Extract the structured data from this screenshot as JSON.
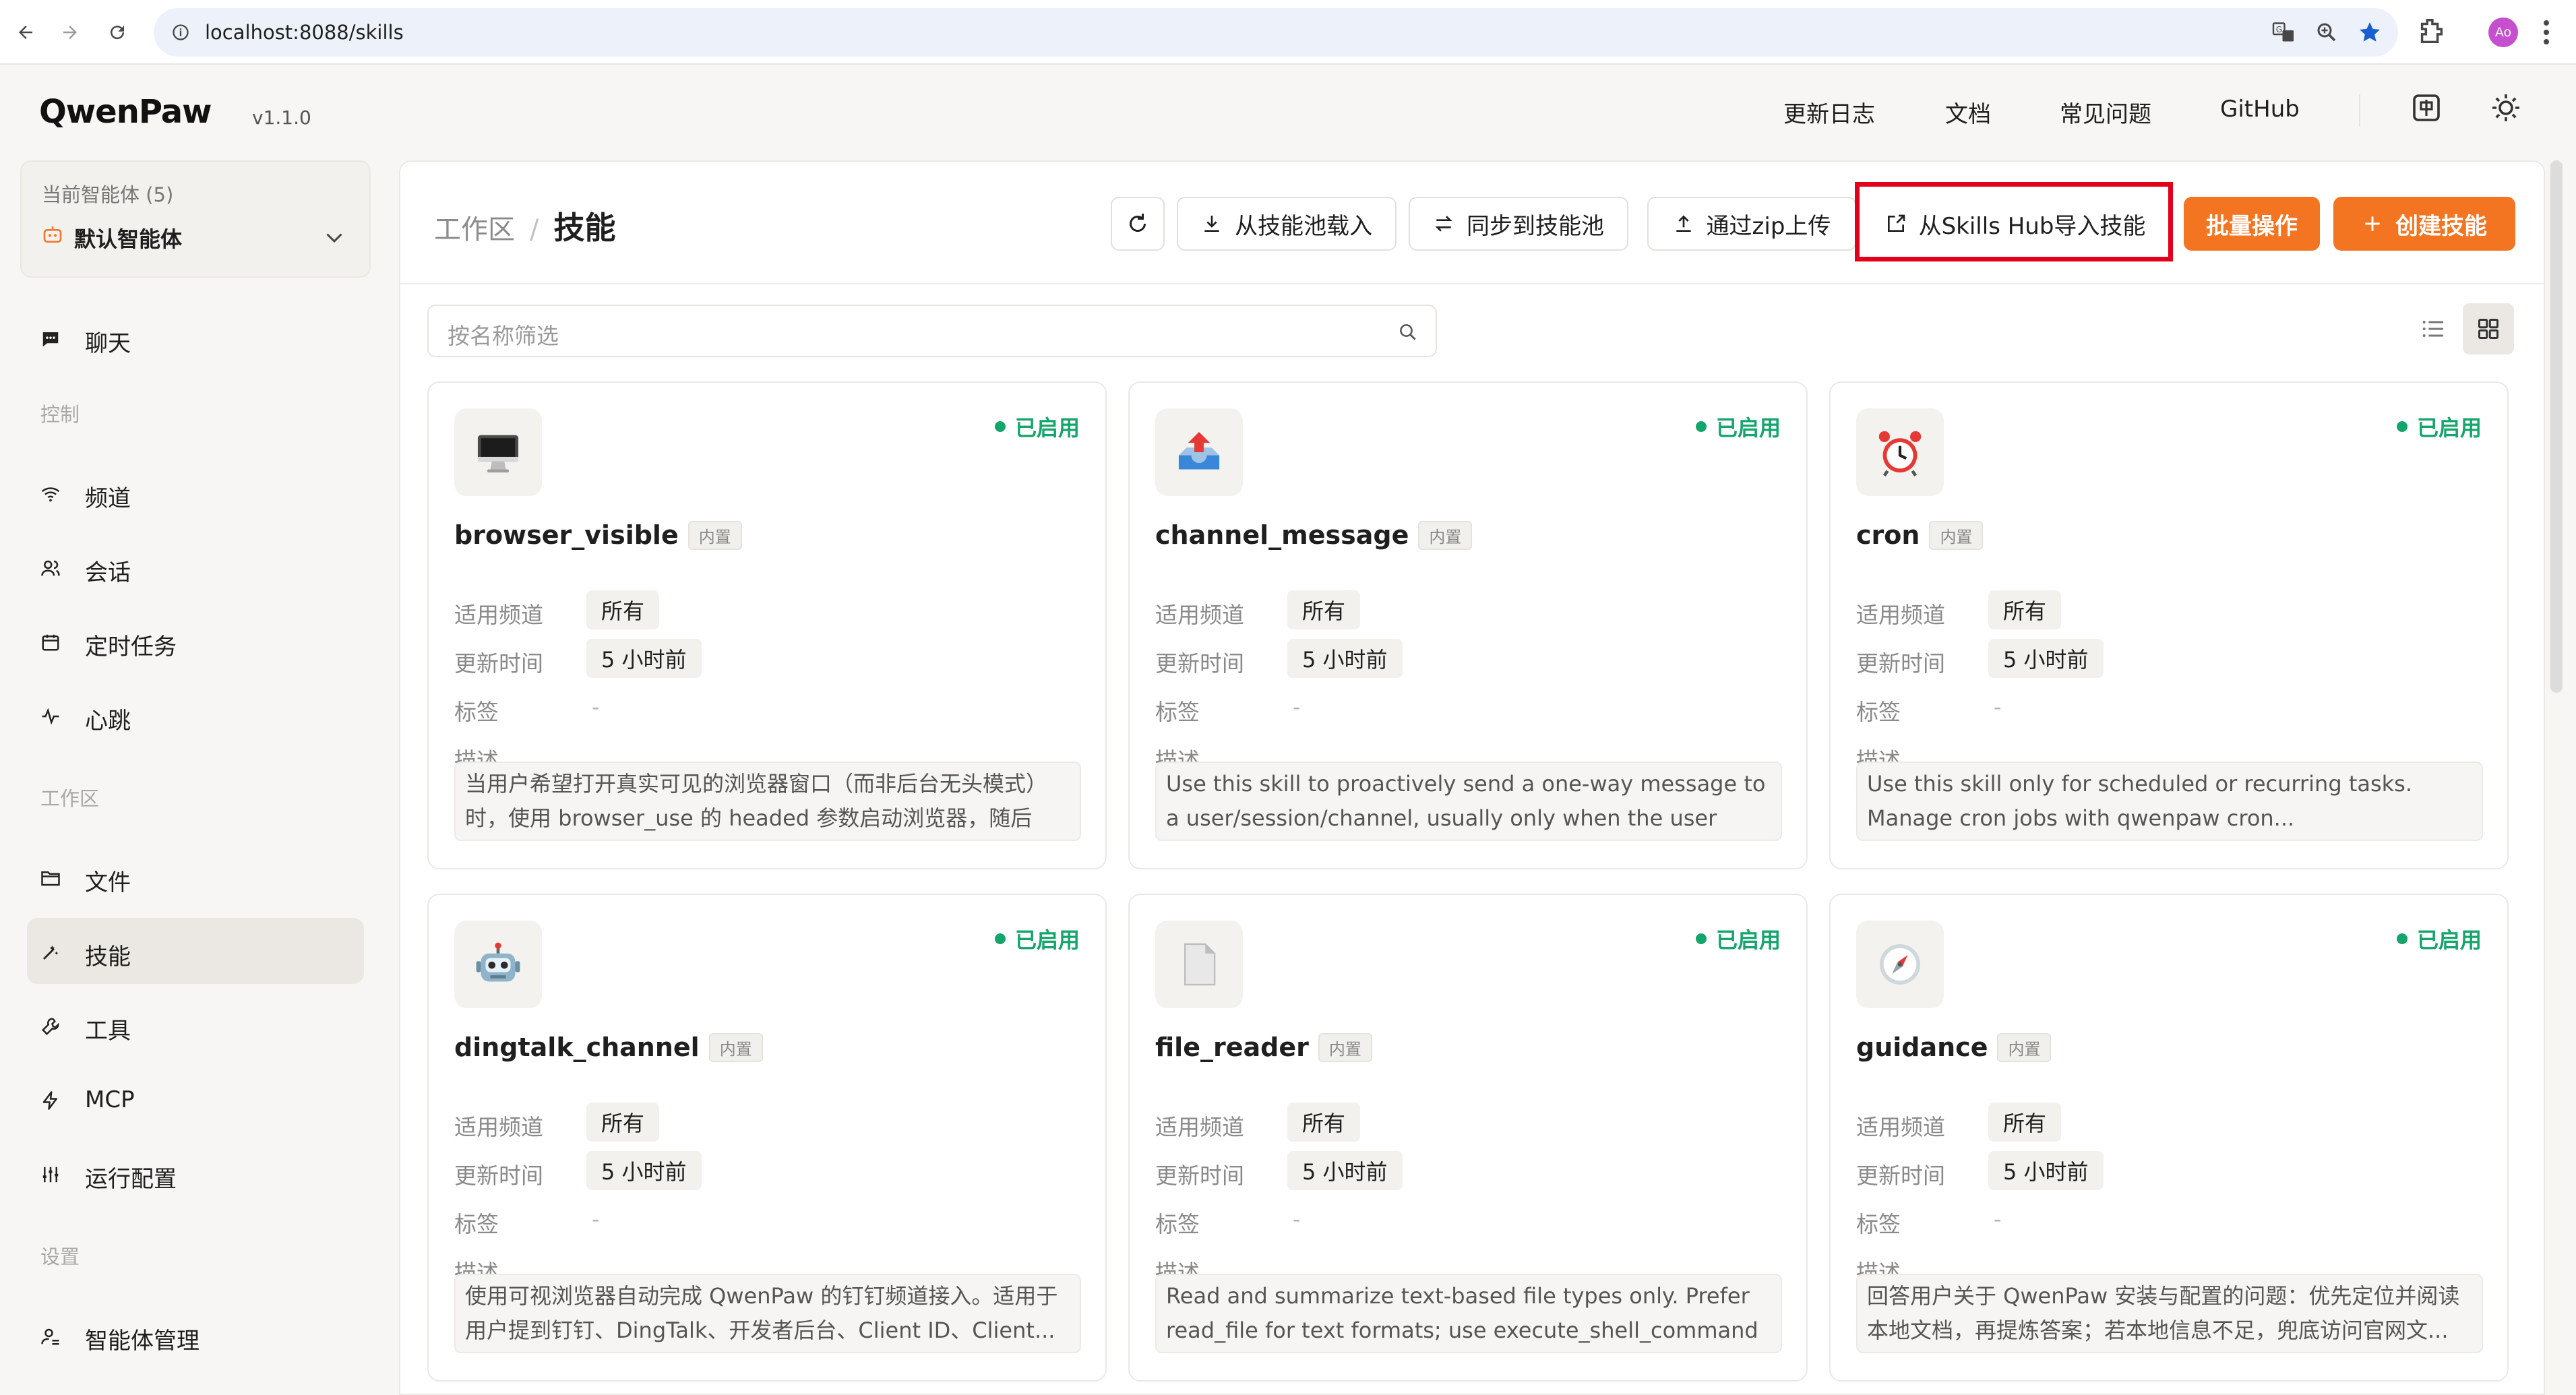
{
  "browser": {
    "url": "localhost:8088/skills",
    "profile_initials": "Ao"
  },
  "app": {
    "logo": "QwenPaw",
    "version": "v1.1.0",
    "topnav": [
      "更新日志",
      "文档",
      "常见问题",
      "GitHub"
    ]
  },
  "agent": {
    "label": "当前智能体 (5)",
    "value": "默认智能体"
  },
  "sidebar": {
    "chat": "聊天",
    "section_control": "控制",
    "control_items": [
      "频道",
      "会话",
      "定时任务",
      "心跳"
    ],
    "section_workspace": "工作区",
    "workspace_items": [
      "文件",
      "技能",
      "工具",
      "MCP",
      "运行配置"
    ],
    "section_settings": "设置",
    "settings_items": [
      "智能体管理"
    ],
    "active": "技能"
  },
  "header": {
    "breadcrumb_parent": "工作区",
    "breadcrumb_sep": "/",
    "title": "技能",
    "buttons": {
      "load_from_pool": "从技能池载入",
      "sync_to_pool": "同步到技能池",
      "upload_zip": "通过zip上传",
      "import_hub": "从Skills Hub导入技能",
      "batch": "批量操作",
      "create": "创建技能"
    }
  },
  "search": {
    "placeholder": "按名称筛选"
  },
  "labels": {
    "channel": "适用频道",
    "updated": "更新时间",
    "tags": "标签",
    "desc": "描述",
    "builtin": "内置",
    "status": "已启用"
  },
  "cards": [
    {
      "name": "browser_visible",
      "icon": "desktop-computer-icon",
      "channel": "所有",
      "updated": "5 小时前",
      "tags": "-",
      "desc": "当用户希望打开真实可见的浏览器窗口（而非后台无头模式）时，使用 browser_use 的 headed 参数启动浏览器，随后可..."
    },
    {
      "name": "channel_message",
      "icon": "outbox-tray-icon",
      "channel": "所有",
      "updated": "5 小时前",
      "tags": "-",
      "desc": "Use this skill to proactively send a one-way message to a user/session/channel, usually only when the user explicitl..."
    },
    {
      "name": "cron",
      "icon": "alarm-clock-icon",
      "channel": "所有",
      "updated": "5 小时前",
      "tags": "-",
      "desc": "Use this skill only for scheduled or recurring tasks. Manage cron jobs with qwenpaw cron..."
    },
    {
      "name": "dingtalk_channel",
      "icon": "robot-icon",
      "channel": "所有",
      "updated": "5 小时前",
      "tags": "-",
      "desc": "使用可视浏览器自动完成 QwenPaw 的钉钉频道接入。适用于用户提到钉钉、DingTalk、开发者后台、Client ID、Client..."
    },
    {
      "name": "file_reader",
      "icon": "document-icon",
      "channel": "所有",
      "updated": "5 小时前",
      "tags": "-",
      "desc": "Read and summarize text-based file types only. Prefer read_file for text formats; use execute_shell_command fo..."
    },
    {
      "name": "guidance",
      "icon": "compass-icon",
      "channel": "所有",
      "updated": "5 小时前",
      "tags": "-",
      "desc": "回答用户关于 QwenPaw 安装与配置的问题：优先定位并阅读本地文档，再提炼答案；若本地信息不足，兜底访问官网文..."
    }
  ]
}
